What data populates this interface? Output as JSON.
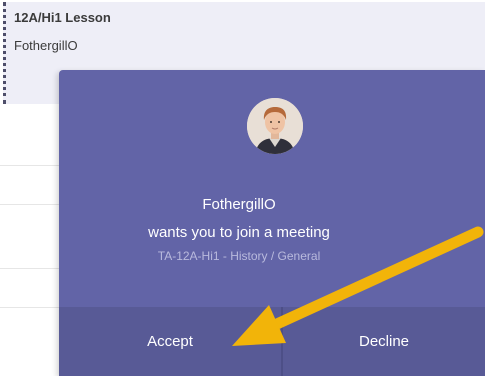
{
  "event": {
    "title": "12A/Hi1 Lesson",
    "organizer": "FothergillO"
  },
  "toast": {
    "caller_name": "FothergillO",
    "message": "wants you to join a meeting",
    "channel": "TA-12A-Hi1 - History / General",
    "accept_label": "Accept",
    "decline_label": "Decline"
  },
  "colors": {
    "toast_bg": "#6264a7",
    "button_bg": "#585a96",
    "event_card_bg": "#eeeef7",
    "arrow": "#f5b800"
  },
  "icons": {
    "annotation": "arrow-annotation-icon"
  }
}
